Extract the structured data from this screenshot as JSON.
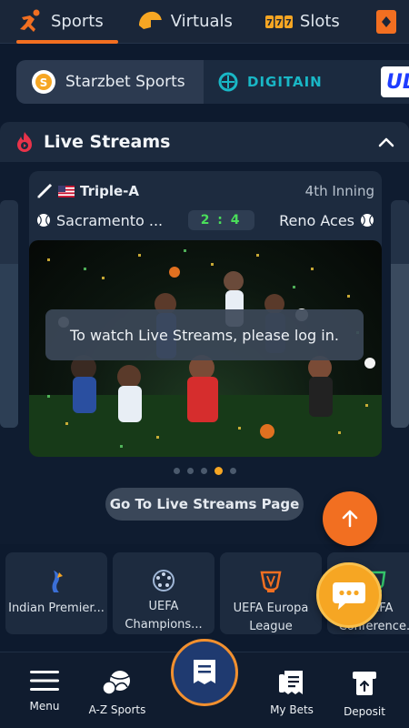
{
  "topnav": {
    "tabs": [
      {
        "label": "Sports",
        "icon": "runner-icon",
        "active": true
      },
      {
        "label": "Virtuals",
        "icon": "helmet-icon"
      },
      {
        "label": "Slots",
        "icon": "slots-777-icon"
      },
      {
        "label": "",
        "icon": "cards-icon"
      }
    ]
  },
  "providers": [
    {
      "label": "Starzbet Sports",
      "active": true
    },
    {
      "label": "DIGITAIN"
    },
    {
      "label": "UL"
    }
  ],
  "live_streams": {
    "title": "Live Streams",
    "match": {
      "league": "Triple-A",
      "period": "4th Inning",
      "home_team": "Sacramento ...",
      "away_team": "Reno Aces",
      "score": "2 : 4"
    },
    "login_message": "To watch Live Streams, please log in.",
    "go_button": "Go To Live Streams Page",
    "dots_count": 5,
    "active_dot": 3
  },
  "competitions": [
    {
      "label": "Indian Premier...",
      "icon": "ipl-icon"
    },
    {
      "label": "UEFA Champions...",
      "icon": "champions-league-icon"
    },
    {
      "label": "UEFA Europa League",
      "icon": "europa-league-icon"
    },
    {
      "label": "UEFA Conference...",
      "icon": "conference-league-icon"
    }
  ],
  "bottom_nav": {
    "menu": "Menu",
    "az_sports": "A-Z Sports",
    "my_bets": "My Bets",
    "deposit": "Deposit"
  },
  "colors": {
    "accent": "#f26f21",
    "chat": "#f6a623",
    "score": "#4ade5a"
  }
}
